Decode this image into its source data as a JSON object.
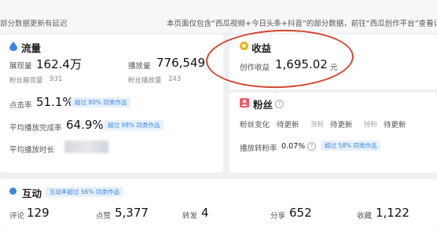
{
  "notice": {
    "left_text": "部分数据更新有延迟",
    "right_text": "本页面仅包含“西瓜视频+今日头条+抖音”的部分数据，前往“西瓜创作平台”查看详细数"
  },
  "traffic": {
    "title": "流量",
    "impressions_label": "展现量",
    "impressions_value": "162.4万",
    "plays_label": "播放量",
    "plays_value": "776,549",
    "fan_impressions_label": "粉丝展现量",
    "fan_impressions_value": "931",
    "fan_plays_label": "粉丝播放量",
    "fan_plays_value": "243",
    "ctr_label": "点击率",
    "ctr_value": "51.1%",
    "ctr_badge": "超过 80% 同类作品",
    "completion_label": "平均播放完成率",
    "completion_value": "64.9%",
    "completion_badge": "超过 98% 同类作品",
    "duration_label": "平均播放时长"
  },
  "earnings": {
    "title": "收益",
    "creation_label": "创作收益",
    "creation_value": "1,695.02",
    "unit": "元"
  },
  "fans": {
    "title": "粉丝",
    "change_label": "粉丝变化",
    "pending": "待更新",
    "gain_label": "涨粉",
    "loss_label": "掉粉",
    "conversion_label": "播放转粉率",
    "conversion_value": "0.07%",
    "conversion_badge": "超过 58% 同类作品"
  },
  "interaction": {
    "title": "互动",
    "badge": "互动率超过 56% 同类作品",
    "comments_label": "评论",
    "comments_value": "129",
    "likes_label": "点赞",
    "likes_value": "5,377",
    "shares_label": "转发",
    "shares_value": "4",
    "share_label": "分享",
    "share_value": "652",
    "favorites_label": "收藏",
    "favorites_value": "1,122"
  },
  "colors": {
    "traffic_icon": "#3a86e0",
    "earnings_icon": "#f2b01e",
    "fans_icon": "#f05a6b",
    "interaction_icon": "#3a86e0",
    "highlight_circle": "#d3462f",
    "badge_text": "#3a86e0"
  },
  "icons": {
    "traffic": "droplet-icon",
    "earnings": "coin-icon",
    "fans": "person-icon",
    "interaction": "dot-icon"
  }
}
